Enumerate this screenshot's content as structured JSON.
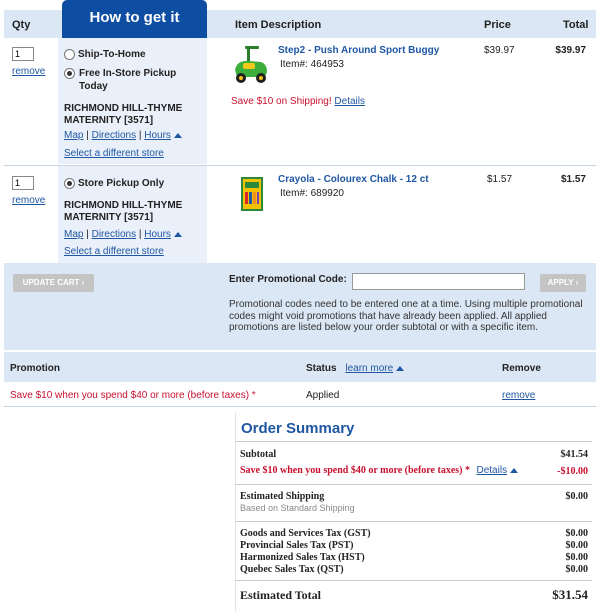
{
  "header": {
    "qty": "Qty",
    "how_to_get_it": "How to get it",
    "item_description": "Item Description",
    "price": "Price",
    "total": "Total"
  },
  "items": [
    {
      "qty": "1",
      "remove": "remove",
      "options": [
        {
          "label": "Ship-To-Home",
          "selected": false
        },
        {
          "label": "Free In-Store Pickup Today",
          "selected": true
        }
      ],
      "store": "RICHMOND HILL-THYME MATERNITY [3571]",
      "map": "Map",
      "directions": "Directions",
      "hours": "Hours",
      "select_store": "Select a different store",
      "name": "Step2 - Push Around Sport Buggy",
      "item_no_label": "Item#:",
      "item_no": "464953",
      "promo_note": "Save $10 on Shipping!",
      "details": "Details",
      "price": "$39.97",
      "total": "$39.97",
      "image_icon": "toy-car-icon"
    },
    {
      "qty": "1",
      "remove": "remove",
      "option": "Store Pickup Only",
      "store": "RICHMOND HILL-THYME MATERNITY [3571]",
      "map": "Map",
      "directions": "Directions",
      "hours": "Hours",
      "select_store": "Select a different store",
      "name": "Crayola - Colourex Chalk - 12 ct",
      "item_no_label": "Item#:",
      "item_no": "689920",
      "price": "$1.57",
      "total": "$1.57",
      "image_icon": "chalk-box-icon"
    }
  ],
  "cart_actions": {
    "update_cart": "UPDATE CART ›",
    "promo_label": "Enter Promotional Code:",
    "promo_value": "",
    "apply": "APPLY ›",
    "promo_note": "Promotional codes need to be entered one at a time. Using multiple promotional codes might void promotions that have already been applied. All applied promotions are listed below your order subtotal or with a specific item."
  },
  "promotions": {
    "col_promotion": "Promotion",
    "col_status": "Status",
    "learn_more": "learn more",
    "col_remove": "Remove",
    "rows": [
      {
        "text": "Save $10 when you spend $40 or more (before taxes) *",
        "status": "Applied",
        "remove": "remove"
      }
    ]
  },
  "order_summary": {
    "title": "Order Summary",
    "subtotal_label": "Subtotal",
    "subtotal": "$41.54",
    "discount_label": "Save $10 when you spend $40 or more (before taxes) *",
    "discount_details": "Details",
    "discount": "-$10.00",
    "shipping_label": "Estimated Shipping",
    "shipping_sub": "Based on Standard Shipping",
    "shipping": "$0.00",
    "taxes": [
      {
        "label": "Goods and Services Tax (GST)",
        "value": "$0.00"
      },
      {
        "label": "Provincial Sales Tax (PST)",
        "value": "$0.00"
      },
      {
        "label": "Harmonized Sales Tax (HST)",
        "value": "$0.00"
      },
      {
        "label": "Quebec Sales Tax (QST)",
        "value": "$0.00"
      }
    ],
    "total_label": "Estimated Total",
    "total": "$31.54"
  },
  "colors": {
    "brand_blue": "#0e4ea2",
    "link_blue": "#1f57a3",
    "header_bg": "#dbe7f5",
    "promo_red": "#c8102e"
  }
}
